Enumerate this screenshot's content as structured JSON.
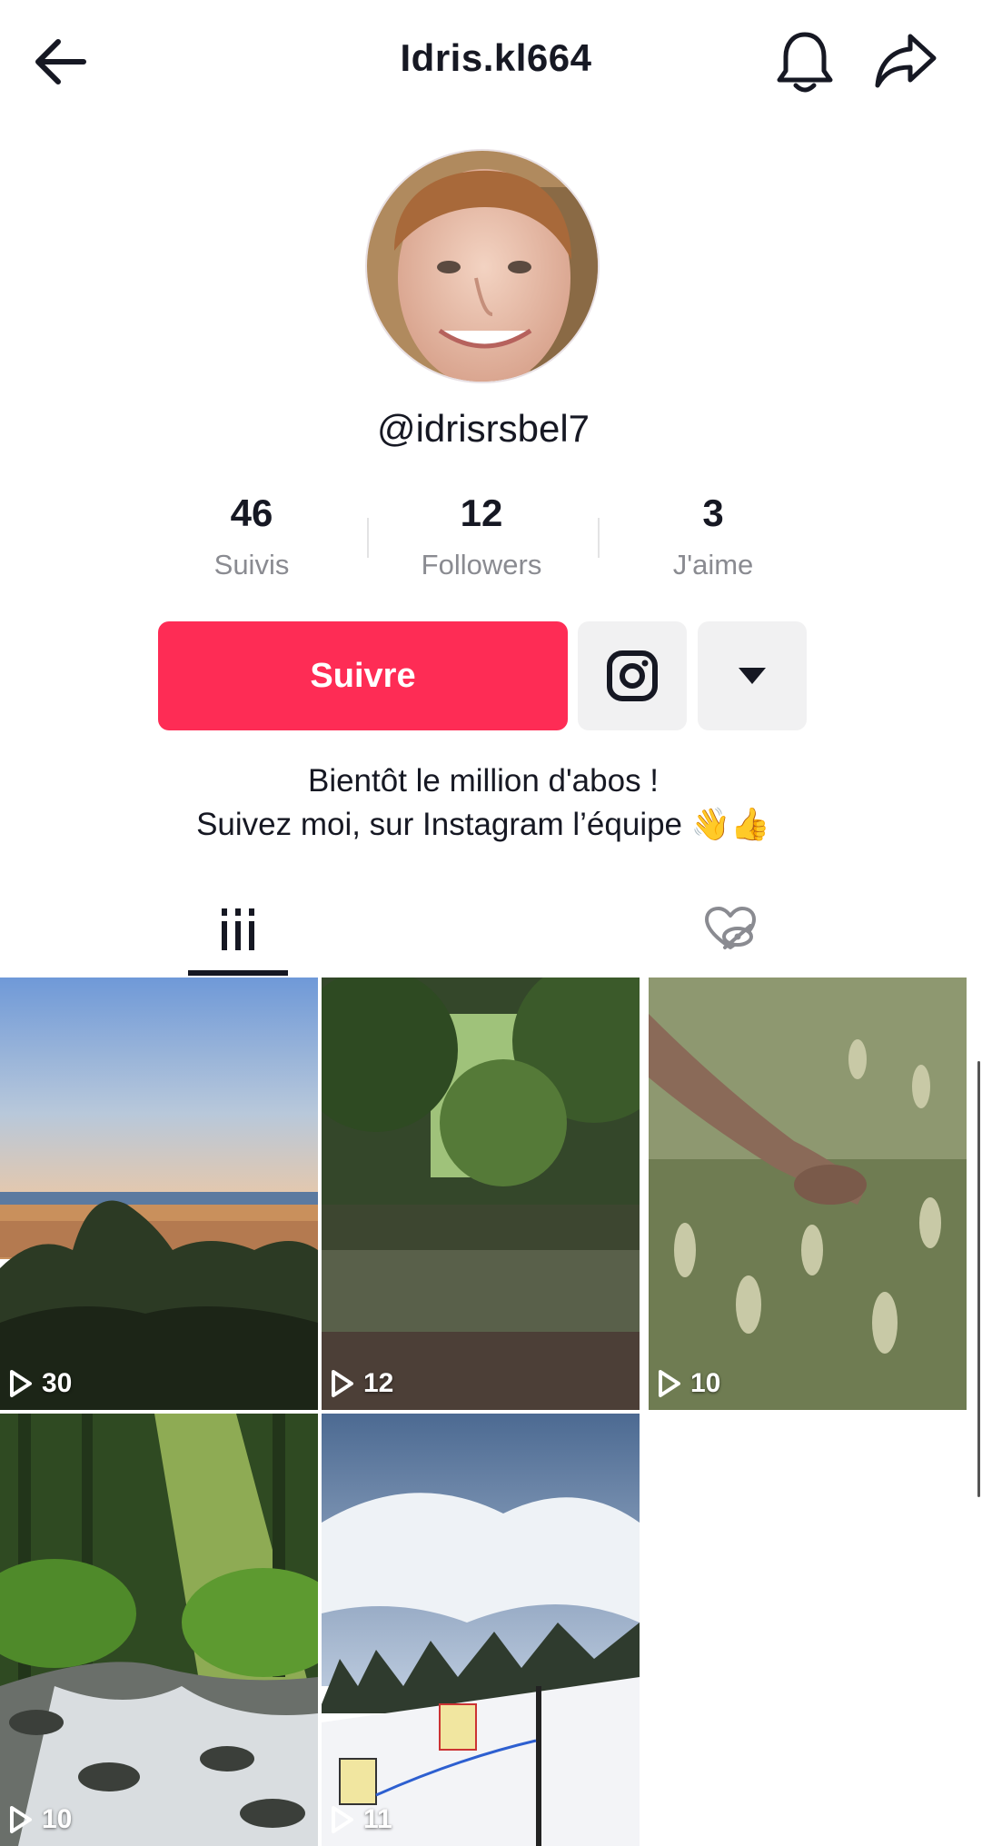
{
  "header": {
    "title": "Idris.kl664",
    "back_icon": "arrow-left-icon",
    "bell_icon": "bell-icon",
    "share_icon": "share-arrow-icon"
  },
  "profile": {
    "handle": "@idrisrsbel7",
    "avatar": "avatar"
  },
  "stats": [
    {
      "num": "46",
      "label": "Suivis"
    },
    {
      "num": "12",
      "label": "Followers"
    },
    {
      "num": "3",
      "label": "J'aime"
    }
  ],
  "actions": {
    "follow_label": "Suivre",
    "instagram_icon": "instagram-icon",
    "more_icon": "caret-down-icon"
  },
  "bio": {
    "line1": "Bientôt le million d'abos !",
    "line2": "Suivez moi, sur Instagram l’équipe 👋👍"
  },
  "tabs": [
    {
      "icon": "grid-videos-icon",
      "selected": true
    },
    {
      "icon": "liked-hidden-icon",
      "selected": false
    }
  ],
  "videos": [
    {
      "views": "30",
      "scene": "city-sky"
    },
    {
      "views": "12",
      "scene": "forest-pond"
    },
    {
      "views": "10",
      "scene": "grass-hand"
    },
    {
      "views": "10",
      "scene": "forest-stream"
    },
    {
      "views": "11",
      "scene": "ski-slope"
    }
  ],
  "colors": {
    "accent": "#fe2c55",
    "text": "#161823",
    "muted": "#8a8b91",
    "button_bg": "#f1f1f2"
  }
}
